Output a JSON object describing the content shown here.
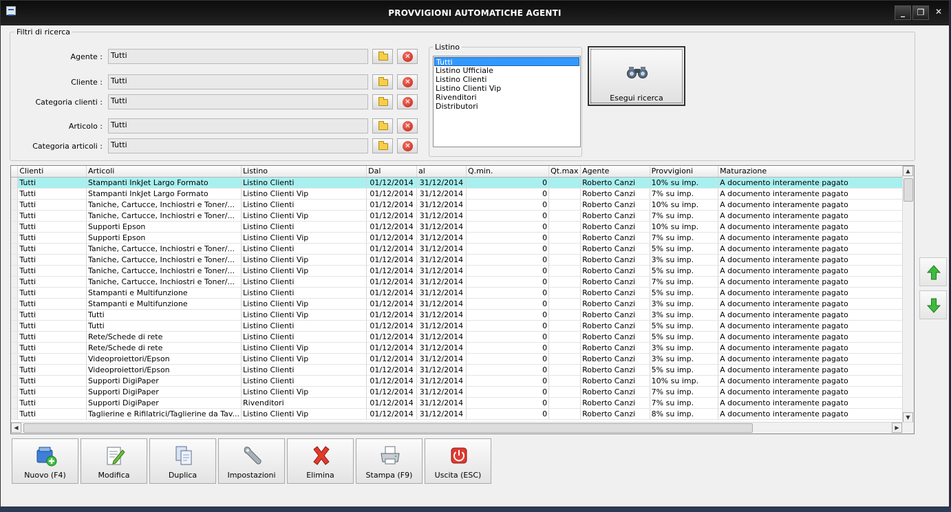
{
  "window": {
    "title": "PROVVIGIONI AUTOMATICHE AGENTI",
    "minimize": "_",
    "maximize": "❐",
    "close": "✕"
  },
  "filters": {
    "legend": "Filtri di ricerca",
    "fields": [
      {
        "label": "Agente :",
        "value": "Tutti"
      },
      {
        "label": "Cliente :",
        "value": "Tutti"
      },
      {
        "label": "Categoria clienti :",
        "value": "Tutti"
      },
      {
        "label": "Articolo :",
        "value": "Tutti"
      },
      {
        "label": "Categoria articoli :",
        "value": "Tutti"
      }
    ],
    "clear_glyph": "✕",
    "listino": {
      "legend": "Listino",
      "options": [
        "Tutti",
        "Listino Ufficiale",
        "Listino Clienti",
        "Listino Clienti Vip",
        "Rivenditori",
        "Distributori"
      ],
      "selected": "Tutti"
    },
    "search_button": "Esegui ricerca"
  },
  "grid": {
    "columns": [
      "Clienti",
      "Articoli",
      "Listino",
      "Dal",
      "al",
      "Q.min.",
      "Qt.max",
      "Agente",
      "Provvigioni",
      "Maturazione"
    ],
    "rows": [
      [
        "Tutti",
        "Stampanti InkJet Largo Formato",
        "Listino Clienti",
        "01/12/2014",
        "31/12/2014",
        "0",
        "",
        "Roberto Canzi",
        "10% su imp.",
        "A documento interamente pagato"
      ],
      [
        "Tutti",
        "Stampanti InkJet Largo Formato",
        "Listino Clienti Vip",
        "01/12/2014",
        "31/12/2014",
        "0",
        "",
        "Roberto Canzi",
        "7% su imp.",
        "A documento interamente pagato"
      ],
      [
        "Tutti",
        "Taniche, Cartucce, Inchiostri e Toner/...",
        "Listino Clienti",
        "01/12/2014",
        "31/12/2014",
        "0",
        "",
        "Roberto Canzi",
        "10% su imp.",
        "A documento interamente pagato"
      ],
      [
        "Tutti",
        "Taniche, Cartucce, Inchiostri e Toner/...",
        "Listino Clienti Vip",
        "01/12/2014",
        "31/12/2014",
        "0",
        "",
        "Roberto Canzi",
        "7% su imp.",
        "A documento interamente pagato"
      ],
      [
        "Tutti",
        "Supporti Epson",
        "Listino Clienti",
        "01/12/2014",
        "31/12/2014",
        "0",
        "",
        "Roberto Canzi",
        "10% su imp.",
        "A documento interamente pagato"
      ],
      [
        "Tutti",
        "Supporti Epson",
        "Listino Clienti Vip",
        "01/12/2014",
        "31/12/2014",
        "0",
        "",
        "Roberto Canzi",
        "7% su imp.",
        "A documento interamente pagato"
      ],
      [
        "Tutti",
        "Taniche, Cartucce, Inchiostri e Toner/...",
        "Listino Clienti",
        "01/12/2014",
        "31/12/2014",
        "0",
        "",
        "Roberto Canzi",
        "5% su imp.",
        "A documento interamente pagato"
      ],
      [
        "Tutti",
        "Taniche, Cartucce, Inchiostri e Toner/...",
        "Listino Clienti Vip",
        "01/12/2014",
        "31/12/2014",
        "0",
        "",
        "Roberto Canzi",
        "3% su imp.",
        "A documento interamente pagato"
      ],
      [
        "Tutti",
        "Taniche, Cartucce, Inchiostri e Toner/...",
        "Listino Clienti Vip",
        "01/12/2014",
        "31/12/2014",
        "0",
        "",
        "Roberto Canzi",
        "5% su imp.",
        "A documento interamente pagato"
      ],
      [
        "Tutti",
        "Taniche, Cartucce, Inchiostri e Toner/...",
        "Listino Clienti",
        "01/12/2014",
        "31/12/2014",
        "0",
        "",
        "Roberto Canzi",
        "7% su imp.",
        "A documento interamente pagato"
      ],
      [
        "Tutti",
        "Stampanti e Multifunzione",
        "Listino Clienti",
        "01/12/2014",
        "31/12/2014",
        "0",
        "",
        "Roberto Canzi",
        "5% su imp.",
        "A documento interamente pagato"
      ],
      [
        "Tutti",
        "Stampanti e Multifunzione",
        "Listino Clienti Vip",
        "01/12/2014",
        "31/12/2014",
        "0",
        "",
        "Roberto Canzi",
        "3% su imp.",
        "A documento interamente pagato"
      ],
      [
        "Tutti",
        "Tutti",
        "Listino Clienti Vip",
        "01/12/2014",
        "31/12/2014",
        "0",
        "",
        "Roberto Canzi",
        "3% su imp.",
        "A documento interamente pagato"
      ],
      [
        "Tutti",
        "Tutti",
        "Listino Clienti",
        "01/12/2014",
        "31/12/2014",
        "0",
        "",
        "Roberto Canzi",
        "5% su imp.",
        "A documento interamente pagato"
      ],
      [
        "Tutti",
        "Rete/Schede di rete",
        "Listino Clienti",
        "01/12/2014",
        "31/12/2014",
        "0",
        "",
        "Roberto Canzi",
        "5% su imp.",
        "A documento interamente pagato"
      ],
      [
        "Tutti",
        "Rete/Schede di rete",
        "Listino Clienti Vip",
        "01/12/2014",
        "31/12/2014",
        "0",
        "",
        "Roberto Canzi",
        "3% su imp.",
        "A documento interamente pagato"
      ],
      [
        "Tutti",
        "Videoproiettori/Epson",
        "Listino Clienti Vip",
        "01/12/2014",
        "31/12/2014",
        "0",
        "",
        "Roberto Canzi",
        "3% su imp.",
        "A documento interamente pagato"
      ],
      [
        "Tutti",
        "Videoproiettori/Epson",
        "Listino Clienti",
        "01/12/2014",
        "31/12/2014",
        "0",
        "",
        "Roberto Canzi",
        "5% su imp.",
        "A documento interamente pagato"
      ],
      [
        "Tutti",
        "Supporti DigiPaper",
        "Listino Clienti",
        "01/12/2014",
        "31/12/2014",
        "0",
        "",
        "Roberto Canzi",
        "10% su imp.",
        "A documento interamente pagato"
      ],
      [
        "Tutti",
        "Supporti DigiPaper",
        "Listino Clienti Vip",
        "01/12/2014",
        "31/12/2014",
        "0",
        "",
        "Roberto Canzi",
        "7% su imp.",
        "A documento interamente pagato"
      ],
      [
        "Tutti",
        "Supporti DigiPaper",
        "Rivenditori",
        "01/12/2014",
        "31/12/2014",
        "0",
        "",
        "Roberto Canzi",
        "7% su imp.",
        "A documento interamente pagato"
      ],
      [
        "Tutti",
        "Taglierine e Rifilatrici/Taglierine da Tav...",
        "Listino Clienti Vip",
        "01/12/2014",
        "31/12/2014",
        "0",
        "",
        "Roberto Canzi",
        "8% su imp.",
        "A documento interamente pagato"
      ]
    ]
  },
  "toolbar": [
    {
      "name": "new",
      "label": "Nuovo (F4)"
    },
    {
      "name": "edit",
      "label": "Modifica"
    },
    {
      "name": "duplicate",
      "label": "Duplica"
    },
    {
      "name": "settings",
      "label": "Impostazioni"
    },
    {
      "name": "delete",
      "label": "Elimina"
    },
    {
      "name": "print",
      "label": "Stampa (F9)"
    },
    {
      "name": "exit",
      "label": "Uscita (ESC)"
    }
  ],
  "colors": {
    "titlebar": "#151515",
    "selected_row": "#a8f0f0",
    "list_selection": "#3399ff",
    "arrow_green": "#35b035"
  }
}
